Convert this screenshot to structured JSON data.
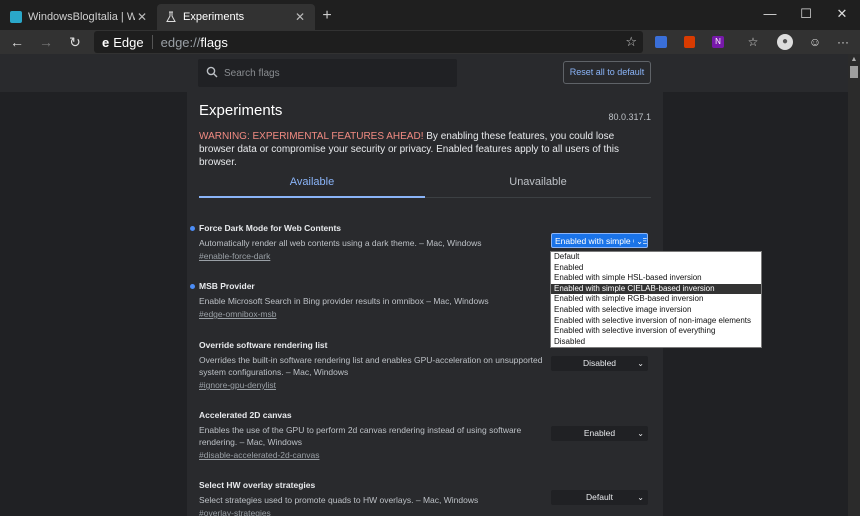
{
  "browser": {
    "tabs": [
      {
        "title": "WindowsBlogItalia | Windows, S"
      },
      {
        "title": "Experiments"
      }
    ],
    "new_tab_glyph": "+",
    "window_controls": [
      "—",
      "☐",
      "✕"
    ],
    "nav": {
      "back": "←",
      "forward": "→",
      "refresh": "↻"
    },
    "address": {
      "brand": "Edge",
      "url_proto": "edge://",
      "url_host": "flags"
    },
    "toolbar_icons": [
      "star-icon",
      "extension-icon",
      "office-icon",
      "onenote-icon",
      "collections-icon",
      "profile-icon",
      "emoji-icon",
      "more-icon"
    ]
  },
  "page": {
    "search": {
      "placeholder": "Search flags"
    },
    "reset_label": "Reset all to default",
    "title": "Experiments",
    "version": "80.0.317.1",
    "warning_prefix": "WARNING: EXPERIMENTAL FEATURES AHEAD!",
    "warning_text": " By enabling these features, you could lose browser data or compromise your security or privacy. Enabled features apply to all users of this browser.",
    "tabs": {
      "available": "Available",
      "unavailable": "Unavailable"
    },
    "experiments": [
      {
        "name": "Force Dark Mode for Web Contents",
        "desc": "Automatically render all web contents using a dark theme. – Mac, Windows",
        "link": "#enable-force-dark",
        "value": "Enabled with simple CIELAB-based inversion",
        "modified": true
      },
      {
        "name": "MSB Provider",
        "desc": "Enable Microsoft Search in Bing provider results in omnibox – Mac, Windows",
        "link": "#edge-omnibox-msb",
        "value": "",
        "modified": true
      },
      {
        "name": "Override software rendering list",
        "desc": "Overrides the built-in software rendering list and enables GPU-acceleration on unsupported system configurations. – Mac, Windows",
        "link": "#ignore-gpu-denylist",
        "value": "Disabled",
        "modified": false
      },
      {
        "name": "Accelerated 2D canvas",
        "desc": "Enables the use of the GPU to perform 2d canvas rendering instead of using software rendering. – Mac, Windows",
        "link": "#disable-accelerated-2d-canvas",
        "value": "Enabled",
        "modified": false
      },
      {
        "name": "Select HW overlay strategies",
        "desc": "Select strategies used to promote quads to HW overlays. – Mac, Windows",
        "link": "#overlay-strategies",
        "value": "Default",
        "modified": false
      }
    ],
    "dropdown_options": [
      "Default",
      "Enabled",
      "Enabled with simple HSL-based inversion",
      "Enabled with simple CIELAB-based inversion",
      "Enabled with simple RGB-based inversion",
      "Enabled with selective image inversion",
      "Enabled with selective inversion of non-image elements",
      "Enabled with selective inversion of everything",
      "Disabled"
    ],
    "dropdown_selected_index": 3
  },
  "colors": {
    "accent": "#8ab4f8",
    "warning": "#f28b82",
    "modified_dot": "#4c8df6",
    "select_active": "#1a73e8"
  }
}
